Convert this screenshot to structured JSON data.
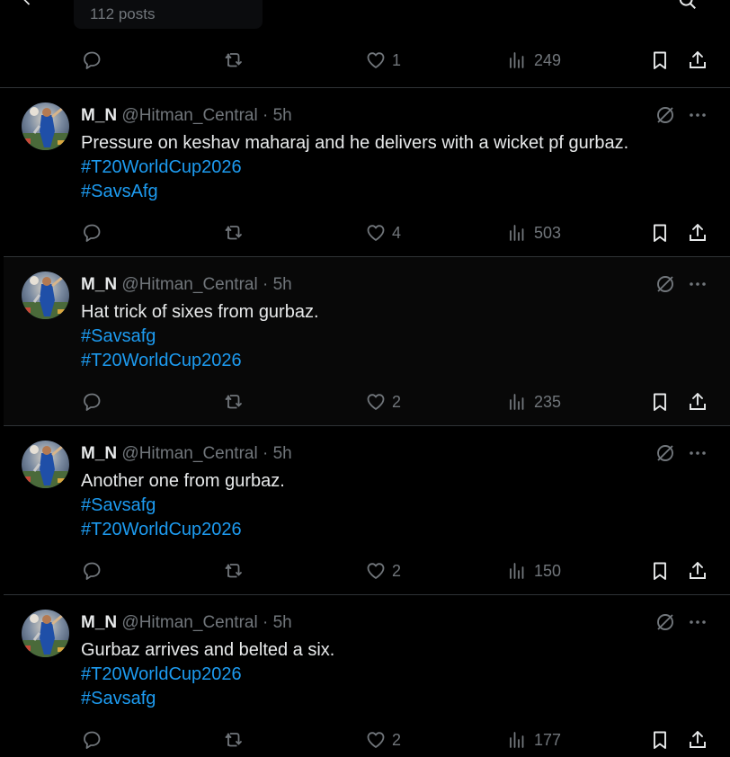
{
  "header": {
    "posts_count": "112 posts"
  },
  "first_tweet_actions": {
    "replies": "",
    "retweets": "",
    "likes": "1",
    "views": "249"
  },
  "tweets": [
    {
      "display_name": "M_N",
      "handle": "@Hitman_Central",
      "separator": "·",
      "time": "5h",
      "text": "Pressure on keshav maharaj and he delivers with a wicket pf gurbaz.",
      "hashtags": [
        "#T20WorldCup2026",
        "#SavsAfg"
      ],
      "likes": "4",
      "views": "503"
    },
    {
      "display_name": "M_N",
      "handle": "@Hitman_Central",
      "separator": "·",
      "time": "5h",
      "text": "Hat trick of sixes from gurbaz.",
      "hashtags": [
        "#Savsafg",
        "#T20WorldCup2026"
      ],
      "likes": "2",
      "views": "235"
    },
    {
      "display_name": "M_N",
      "handle": "@Hitman_Central",
      "separator": "·",
      "time": "5h",
      "text": "Another one from gurbaz.",
      "hashtags": [
        "#Savsafg",
        "#T20WorldCup2026"
      ],
      "likes": "2",
      "views": "150"
    },
    {
      "display_name": "M_N",
      "handle": "@Hitman_Central",
      "separator": "·",
      "time": "5h",
      "text": "Gurbaz arrives and belted a six.",
      "hashtags": [
        "#T20WorldCup2026",
        "#Savsafg"
      ],
      "likes": "2",
      "views": "177"
    }
  ],
  "colors": {
    "background": "#000000",
    "text_primary": "#e7e9ea",
    "text_secondary": "#71767b",
    "link": "#1d9bf0",
    "divider": "#2f3336"
  },
  "icons": {
    "reply": "reply-icon",
    "retweet": "retweet-icon",
    "like": "heart-icon",
    "views": "views-icon",
    "bookmark": "bookmark-icon",
    "share": "share-icon",
    "grok": "grok-icon",
    "more": "more-icon",
    "back": "back-arrow-icon",
    "search": "search-icon"
  }
}
